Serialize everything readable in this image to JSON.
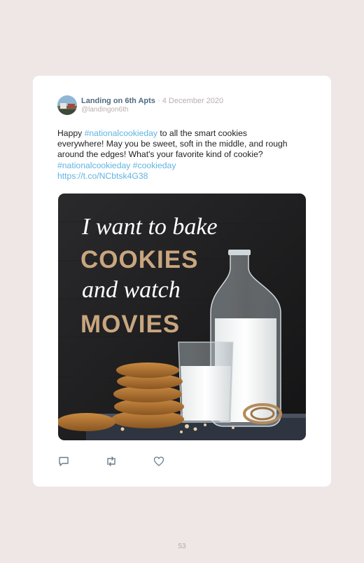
{
  "tweet": {
    "display_name": "Landing on 6th Apts",
    "separator": "·",
    "date": "4 December 2020",
    "handle": "@landingon6th",
    "text_happy": "Happy ",
    "hashtag_national": "#nationalcookieday",
    "text_body": " to all the smart cookies everywhere! May you be sweet, soft in the middle, and rough around the edges! What's your favorite kind of cookie? ",
    "hashtag_national_2": "#nationalcookieday",
    "hashtag_cookieday": "#cookieday",
    "link": "https://t.co/NCbtsk4G38",
    "link_color": "#5fb4e2"
  },
  "media": {
    "line1": "I want to bake",
    "line2": "COOKIES",
    "line3": "and watch",
    "line4": "MOVIES",
    "accent_color": "#c9a67f"
  },
  "actions": [
    {
      "icon": "reply-icon"
    },
    {
      "icon": "retweet-icon"
    },
    {
      "icon": "like-icon"
    }
  ],
  "page_number": "53"
}
